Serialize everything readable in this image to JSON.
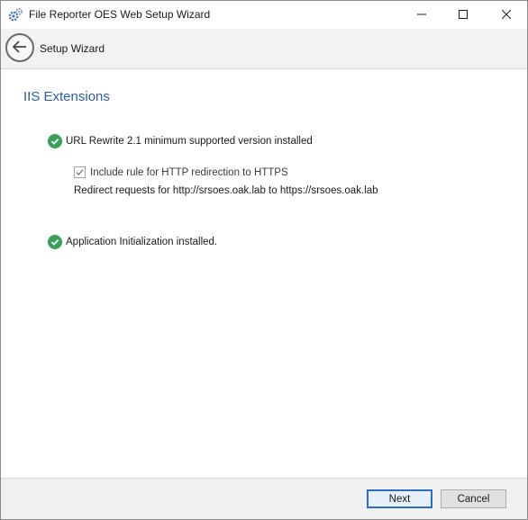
{
  "window": {
    "title": "File Reporter OES Web Setup Wizard",
    "app_icon": "gears-icon",
    "controls": [
      "minimize-icon",
      "maximize-icon",
      "close-icon"
    ]
  },
  "header": {
    "back_icon": "back-arrow-icon",
    "title": "Setup Wizard"
  },
  "main": {
    "section_title": "IIS Extensions",
    "items": [
      {
        "icon": "check-circle-icon",
        "text": "URL Rewrite 2.1 minimum supported version installed"
      },
      {
        "icon": "check-circle-icon",
        "text": "Application Initialization installed."
      }
    ],
    "https_redirect": {
      "checked": true,
      "label": "Include rule for HTTP redirection to HTTPS",
      "detail": "Redirect requests for http://srsoes.oak.lab to https://srsoes.oak.lab"
    }
  },
  "footer": {
    "next_label": "Next",
    "cancel_label": "Cancel"
  },
  "colors": {
    "accent": "#2e5e9e",
    "success": "#3aa05a",
    "default_button_border": "#2b6cc4"
  }
}
